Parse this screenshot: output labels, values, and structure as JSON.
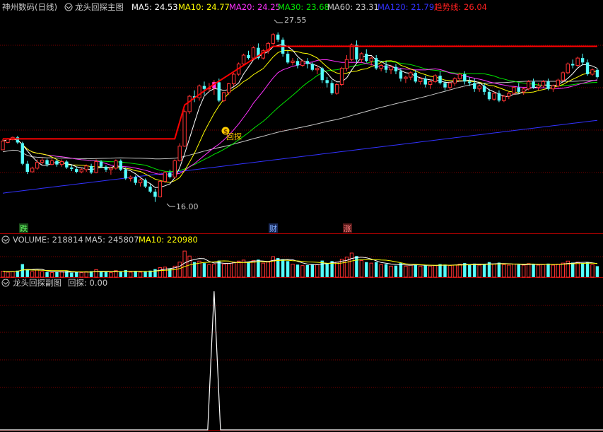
{
  "main_header": {
    "stock": "神州数码(日线)",
    "formula": "龙头回探主图",
    "ma5": "MA5: 24.53",
    "ma10": "MA10: 24.77",
    "ma20": "MA20: 24.25",
    "ma30": "MA30: 23.68",
    "ma60": "MA60: 23.31",
    "ma120": "MA120: 21.79",
    "trend": "趋势线: 26.04"
  },
  "volume_header": {
    "name": "VOLUME: 218814",
    "ma5": "MA5: 245807",
    "ma10": "MA10: 220980"
  },
  "sub_header": {
    "formula": "龙头回探副图",
    "value": "回探: 0.00"
  },
  "annotations": {
    "high_label": "27.55",
    "low_label": "16.00",
    "signal_label": "回探",
    "signal_icon": "$",
    "event_fall": "跌",
    "event_finance": "财",
    "event_rise": "涨"
  },
  "colors": {
    "up": "#ff3232",
    "down": "#54ffff",
    "ma5": "#ffffff",
    "ma10": "#ffff00",
    "ma20": "#ff32ff",
    "ma30": "#00e600",
    "ma60": "#c8c8c8",
    "ma120": "#3232ff",
    "trend": "#ff0000",
    "grid": "#7a0000"
  },
  "chart_data": {
    "type": "candlestick",
    "price_range": [
      15.5,
      28.6
    ],
    "volume_max": 620000,
    "candles": [
      [
        19.55,
        20.3,
        20.15,
        19.9,
        120000
      ],
      [
        20.05,
        20.35,
        20.3,
        20.0,
        100000
      ],
      [
        20.25,
        20.45,
        20.4,
        20.2,
        110000
      ],
      [
        20.4,
        20.5,
        20.05,
        19.95,
        130000
      ],
      [
        20.0,
        20.1,
        18.6,
        18.5,
        260000
      ],
      [
        18.6,
        18.8,
        18.05,
        17.9,
        160000
      ],
      [
        18.05,
        18.4,
        18.3,
        18.0,
        110000
      ],
      [
        18.3,
        18.9,
        18.7,
        18.2,
        140000
      ],
      [
        18.7,
        19.0,
        18.85,
        18.55,
        110000
      ],
      [
        18.85,
        18.95,
        18.55,
        18.4,
        100000
      ],
      [
        18.55,
        18.95,
        18.8,
        18.5,
        90000
      ],
      [
        18.8,
        18.9,
        18.55,
        18.4,
        100000
      ],
      [
        18.55,
        18.9,
        18.75,
        18.4,
        110000
      ],
      [
        18.75,
        18.85,
        18.35,
        18.25,
        120000
      ],
      [
        18.35,
        18.5,
        18.25,
        18.1,
        90000
      ],
      [
        18.25,
        18.4,
        18.05,
        17.95,
        100000
      ],
      [
        18.05,
        18.3,
        18.2,
        17.95,
        90000
      ],
      [
        18.2,
        18.55,
        18.45,
        18.05,
        110000
      ],
      [
        18.45,
        18.6,
        18.0,
        17.9,
        120000
      ],
      [
        18.0,
        18.9,
        18.75,
        17.95,
        150000
      ],
      [
        18.75,
        18.85,
        18.4,
        18.3,
        110000
      ],
      [
        18.4,
        18.5,
        18.2,
        18.05,
        100000
      ],
      [
        18.2,
        18.4,
        18.3,
        17.85,
        90000
      ],
      [
        18.3,
        18.9,
        18.8,
        18.2,
        130000
      ],
      [
        18.8,
        18.9,
        18.2,
        18.1,
        120000
      ],
      [
        18.2,
        18.35,
        17.6,
        17.5,
        140000
      ],
      [
        17.6,
        17.8,
        17.7,
        17.4,
        100000
      ],
      [
        17.7,
        17.8,
        17.3,
        17.15,
        110000
      ],
      [
        17.3,
        17.6,
        17.5,
        17.05,
        100000
      ],
      [
        17.5,
        17.6,
        17.05,
        16.95,
        120000
      ],
      [
        17.05,
        17.2,
        16.7,
        16.6,
        130000
      ],
      [
        16.7,
        16.9,
        16.35,
        16.0,
        160000
      ],
      [
        16.35,
        17.5,
        17.4,
        16.3,
        190000
      ],
      [
        17.4,
        18.1,
        18.0,
        17.3,
        200000
      ],
      [
        18.0,
        18.2,
        17.7,
        17.6,
        170000
      ],
      [
        17.7,
        18.9,
        18.8,
        17.6,
        220000
      ],
      [
        18.8,
        20.0,
        19.8,
        18.75,
        300000
      ],
      [
        19.8,
        22.3,
        22.15,
        19.75,
        520000
      ],
      [
        22.15,
        23.3,
        23.2,
        22.0,
        420000
      ],
      [
        23.2,
        23.6,
        23.1,
        22.8,
        300000
      ],
      [
        23.1,
        24.0,
        23.9,
        22.9,
        320000
      ],
      [
        23.9,
        24.2,
        23.7,
        23.3,
        280000
      ],
      [
        23.7,
        24.1,
        23.75,
        23.5,
        250000
      ],
      [
        23.75,
        24.3,
        24.15,
        23.3,
        260000
      ],
      [
        24.15,
        24.4,
        22.9,
        22.8,
        330000
      ],
      [
        22.9,
        23.5,
        23.45,
        22.8,
        260000
      ],
      [
        23.45,
        24.1,
        24.05,
        23.3,
        270000
      ],
      [
        24.05,
        24.8,
        24.7,
        23.9,
        300000
      ],
      [
        24.7,
        25.5,
        25.4,
        24.6,
        320000
      ],
      [
        25.4,
        26.1,
        26.0,
        25.3,
        340000
      ],
      [
        26.0,
        26.3,
        25.8,
        25.7,
        300000
      ],
      [
        25.8,
        26.6,
        26.5,
        25.7,
        330000
      ],
      [
        26.5,
        26.8,
        25.8,
        25.7,
        350000
      ],
      [
        25.8,
        26.4,
        26.3,
        25.7,
        280000
      ],
      [
        26.3,
        26.9,
        26.8,
        26.1,
        300000
      ],
      [
        26.8,
        27.5,
        27.4,
        26.7,
        410000
      ],
      [
        27.4,
        27.55,
        27.05,
        26.9,
        380000
      ],
      [
        27.05,
        27.2,
        26.1,
        25.9,
        360000
      ],
      [
        26.1,
        26.3,
        25.5,
        25.4,
        320000
      ],
      [
        25.5,
        25.8,
        25.6,
        25.3,
        260000
      ],
      [
        25.6,
        25.8,
        25.3,
        25.1,
        250000
      ],
      [
        25.3,
        25.7,
        25.6,
        25.2,
        230000
      ],
      [
        25.6,
        25.8,
        25.4,
        25.1,
        240000
      ],
      [
        25.4,
        25.5,
        25.0,
        24.9,
        260000
      ],
      [
        25.0,
        25.3,
        25.1,
        24.7,
        250000
      ],
      [
        25.1,
        25.2,
        24.3,
        24.1,
        330000
      ],
      [
        24.3,
        24.5,
        24.1,
        23.8,
        280000
      ],
      [
        24.1,
        24.3,
        23.4,
        23.3,
        320000
      ],
      [
        23.4,
        24.1,
        24.0,
        23.3,
        300000
      ],
      [
        24.0,
        25.2,
        25.1,
        23.9,
        360000
      ],
      [
        25.1,
        26.0,
        25.7,
        24.9,
        400000
      ],
      [
        25.7,
        26.8,
        26.7,
        25.6,
        480000
      ],
      [
        26.7,
        27.0,
        25.7,
        25.5,
        420000
      ],
      [
        25.7,
        26.2,
        26.1,
        25.5,
        330000
      ],
      [
        26.1,
        26.4,
        25.6,
        25.5,
        300000
      ],
      [
        25.6,
        25.9,
        25.8,
        25.3,
        280000
      ],
      [
        25.8,
        26.0,
        25.1,
        25.0,
        300000
      ],
      [
        25.1,
        25.4,
        25.3,
        24.9,
        250000
      ],
      [
        25.3,
        25.6,
        25.0,
        24.8,
        260000
      ],
      [
        25.0,
        25.3,
        25.2,
        24.7,
        220000
      ],
      [
        25.2,
        25.4,
        24.9,
        24.7,
        230000
      ],
      [
        24.9,
        25.1,
        24.4,
        24.2,
        280000
      ],
      [
        24.4,
        24.6,
        24.5,
        24.1,
        220000
      ],
      [
        24.5,
        24.9,
        24.8,
        24.3,
        240000
      ],
      [
        24.8,
        25.0,
        24.2,
        24.1,
        260000
      ],
      [
        24.2,
        24.5,
        24.4,
        24.0,
        220000
      ],
      [
        24.4,
        24.6,
        24.0,
        23.8,
        240000
      ],
      [
        24.0,
        24.3,
        24.2,
        23.7,
        220000
      ],
      [
        24.2,
        24.7,
        24.6,
        24.1,
        230000
      ],
      [
        24.6,
        24.9,
        24.1,
        24.0,
        260000
      ],
      [
        24.1,
        24.3,
        23.8,
        23.6,
        250000
      ],
      [
        23.8,
        24.2,
        24.1,
        23.6,
        230000
      ],
      [
        24.1,
        24.5,
        24.4,
        23.9,
        240000
      ],
      [
        24.4,
        24.8,
        24.7,
        24.2,
        260000
      ],
      [
        24.7,
        24.9,
        24.2,
        24.0,
        280000
      ],
      [
        24.2,
        24.5,
        24.1,
        23.9,
        250000
      ],
      [
        24.1,
        24.4,
        23.7,
        23.5,
        270000
      ],
      [
        23.7,
        24.0,
        23.9,
        23.5,
        240000
      ],
      [
        23.9,
        24.1,
        23.5,
        23.3,
        260000
      ],
      [
        23.5,
        23.7,
        23.0,
        22.9,
        300000
      ],
      [
        23.0,
        23.5,
        23.4,
        22.9,
        260000
      ],
      [
        23.4,
        23.6,
        22.9,
        22.8,
        290000
      ],
      [
        22.9,
        23.3,
        23.2,
        22.8,
        250000
      ],
      [
        23.2,
        23.5,
        23.4,
        23.0,
        240000
      ],
      [
        23.4,
        23.9,
        23.8,
        23.3,
        260000
      ],
      [
        23.8,
        24.1,
        23.5,
        23.4,
        250000
      ],
      [
        23.5,
        23.8,
        23.7,
        23.3,
        240000
      ],
      [
        23.7,
        24.3,
        24.2,
        23.6,
        270000
      ],
      [
        24.2,
        24.4,
        23.8,
        23.7,
        260000
      ],
      [
        23.8,
        24.1,
        23.9,
        23.6,
        240000
      ],
      [
        23.9,
        24.3,
        24.2,
        23.8,
        250000
      ],
      [
        24.2,
        24.4,
        23.7,
        23.6,
        270000
      ],
      [
        23.7,
        24.0,
        23.9,
        23.5,
        240000
      ],
      [
        23.9,
        24.4,
        24.3,
        23.8,
        260000
      ],
      [
        24.3,
        24.9,
        24.8,
        24.2,
        280000
      ],
      [
        24.8,
        25.5,
        25.4,
        24.7,
        320000
      ],
      [
        25.4,
        25.7,
        25.3,
        25.1,
        290000
      ],
      [
        25.3,
        25.9,
        25.8,
        25.2,
        300000
      ],
      [
        25.8,
        26.1,
        25.5,
        25.3,
        280000
      ],
      [
        25.5,
        25.7,
        24.7,
        24.6,
        300000
      ],
      [
        24.7,
        25.1,
        25.0,
        24.6,
        250000
      ],
      [
        25.0,
        25.1,
        24.5,
        24.4,
        219000
      ]
    ],
    "trend_line": {
      "segments": [
        {
          "from_index": 0,
          "to_index": 35,
          "value": 20.3
        },
        {
          "from_index": 35,
          "to_index": 37,
          "value_from": 20.3,
          "value_to": 22.6
        },
        {
          "from_index": 37,
          "to_index": 42,
          "value_from": 22.6,
          "value_to": 23.8
        },
        {
          "from_index": 42,
          "to_index": 55,
          "value_from": 23.8,
          "value_to": 26.6
        },
        {
          "from_index": 55,
          "to_index": 121,
          "value": 26.6
        }
      ]
    },
    "signal_index": 43,
    "signal_value": 20.1,
    "event_markers": [
      {
        "index": 4,
        "label_key": "event_fall"
      },
      {
        "index": 52,
        "label_key": "event_finance"
      },
      {
        "index": 65,
        "label_key": "event_rise"
      }
    ],
    "subchart_spike_index": 43,
    "subchart_spike_value": 1
  }
}
